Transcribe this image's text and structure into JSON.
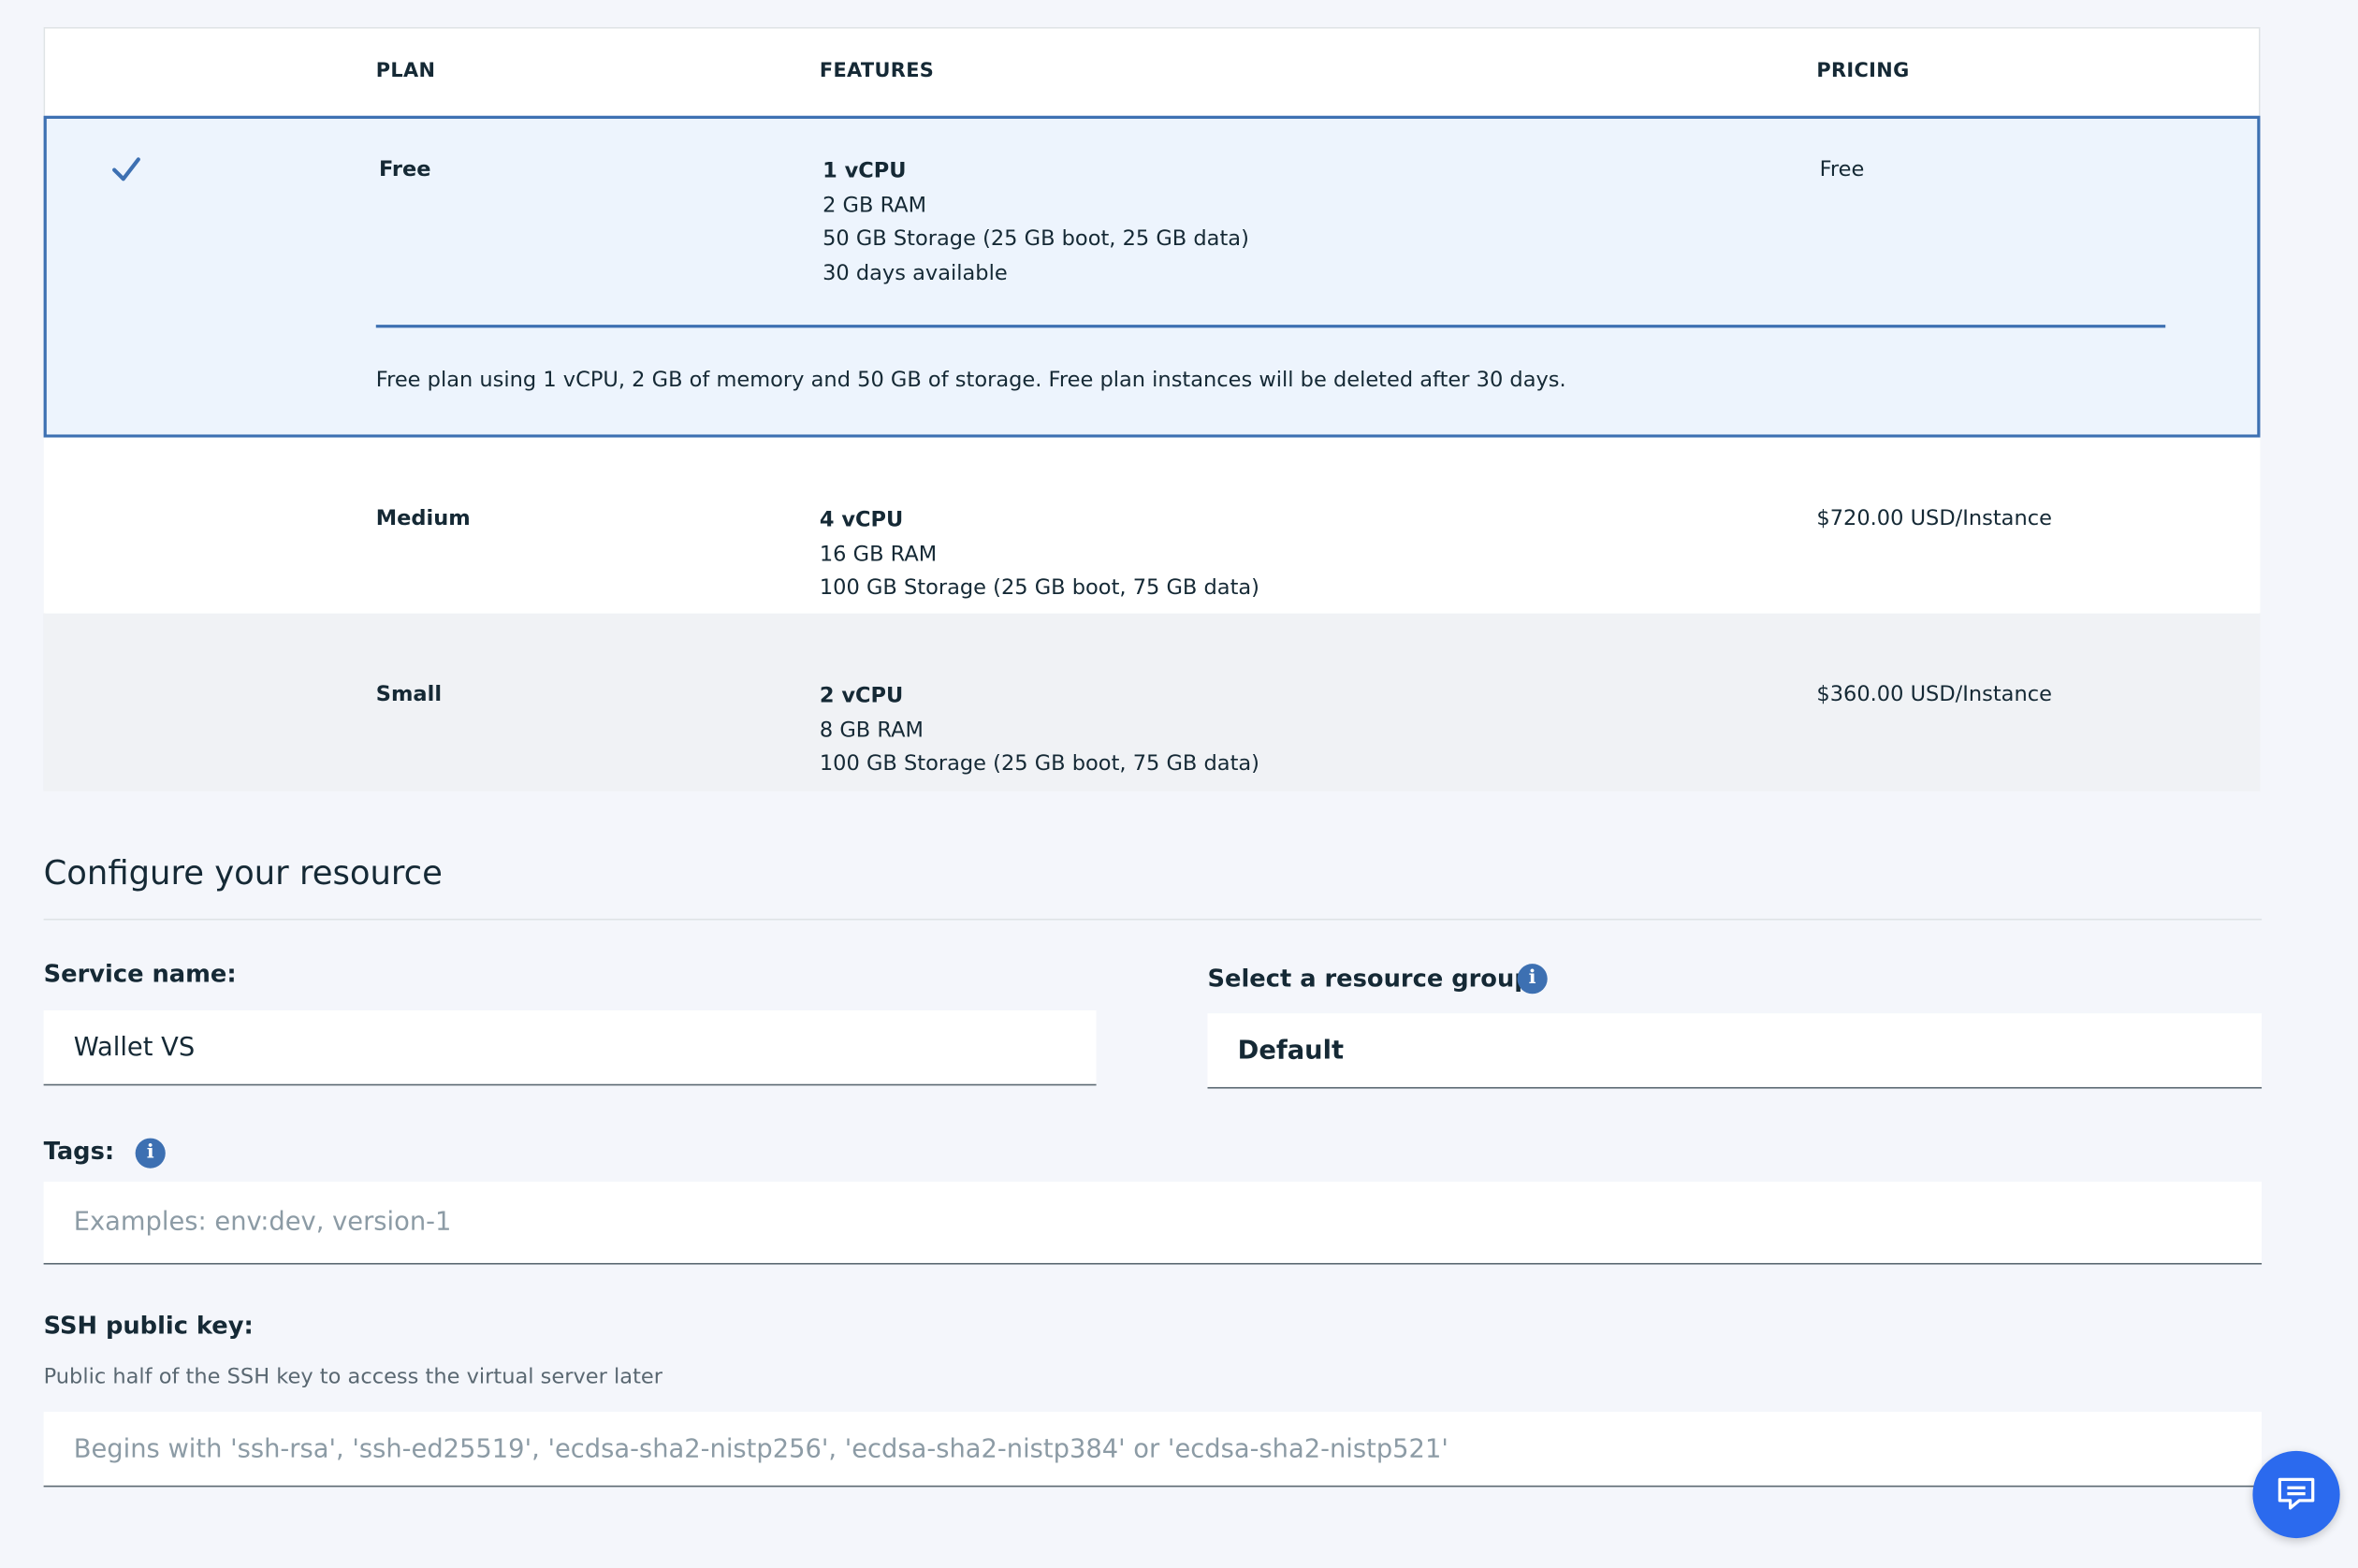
{
  "plan_table": {
    "columns": {
      "plan": "PLAN",
      "features": "FEATURES",
      "pricing": "PRICING"
    },
    "plans": [
      {
        "name": "Free",
        "selected": true,
        "features": [
          "1 vCPU",
          "2 GB RAM",
          "50 GB Storage (25 GB boot, 25 GB data)",
          "30 days available"
        ],
        "price": "Free",
        "description": "Free plan using 1 vCPU, 2 GB of memory and 50 GB of storage. Free plan instances will be deleted after 30 days."
      },
      {
        "name": "Medium",
        "selected": false,
        "features": [
          "4 vCPU",
          "16 GB RAM",
          "100 GB Storage (25 GB boot, 75 GB data)"
        ],
        "price": "$720.00 USD/Instance"
      },
      {
        "name": "Small",
        "selected": false,
        "features": [
          "2 vCPU",
          "8 GB RAM",
          "100 GB Storage (25 GB boot, 75 GB data)"
        ],
        "price": "$360.00 USD/Instance"
      }
    ]
  },
  "configure": {
    "title": "Configure your resource",
    "service_name": {
      "label": "Service name:",
      "value": "Wallet VS"
    },
    "resource_group": {
      "label": "Select a resource group:",
      "value": "Default",
      "info_icon": "info-icon"
    },
    "tags": {
      "label": "Tags:",
      "placeholder": "Examples: env:dev, version-1",
      "info_icon": "info-icon"
    },
    "ssh_key": {
      "label": "SSH public key:",
      "helper": "Public half of the SSH key to access the virtual server later",
      "placeholder": "Begins with 'ssh-rsa', 'ssh-ed25519', 'ecdsa-sha2-nistp256', 'ecdsa-sha2-nistp384' or 'ecdsa-sha2-nistp521'"
    }
  },
  "chat_button": {
    "icon": "chat-icon"
  },
  "colors": {
    "accent": "#3d70b2",
    "selected_row_bg": "#edf4fd",
    "chat_button": "#2b6aee",
    "page_bg": "#f4f6fb"
  }
}
